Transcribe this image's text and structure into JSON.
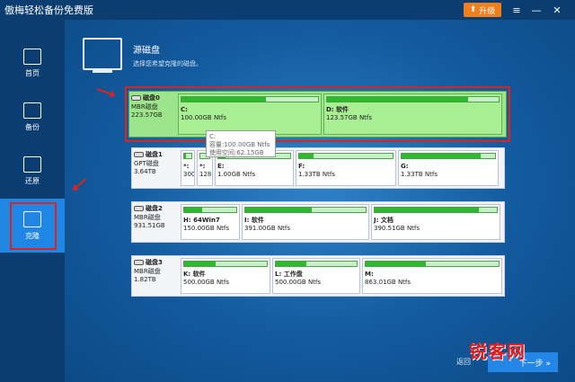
{
  "app": {
    "title": "傲梅轻松备份免费版",
    "upgrade_label": "升级",
    "win_controls": [
      "≡",
      "—",
      "✕"
    ]
  },
  "sidebar": {
    "items": [
      {
        "label": "首页",
        "icon": "home-icon"
      },
      {
        "label": "备份",
        "icon": "backup-icon"
      },
      {
        "label": "还原",
        "icon": "restore-icon"
      },
      {
        "label": "克隆",
        "icon": "clone-icon",
        "active": true
      }
    ]
  },
  "header": {
    "title": "源磁盘",
    "subtitle": "选择您希望克隆的磁盘。",
    "icon": "monitor-icon"
  },
  "disks": [
    {
      "name": "磁盘0",
      "type": "MBR磁盘",
      "size": "223.57GB",
      "selected": true,
      "partitions": [
        {
          "label": "C:",
          "size": "100.00GB Ntfs",
          "used": 0.62
        },
        {
          "label": "D: 软件",
          "size": "123.57GB Ntfs",
          "used": 0.82
        }
      ]
    },
    {
      "name": "磁盘1",
      "type": "GPT磁盘",
      "size": "3.64TB",
      "partitions": [
        {
          "label": "*:",
          "size": "300...",
          "used": 0.3
        },
        {
          "label": "*:",
          "size": "128...",
          "used": 0.0
        },
        {
          "label": "E:",
          "size": "1.00GB Ntfs",
          "used": 0.1
        },
        {
          "label": "F:",
          "size": "1.33TB Ntfs",
          "used": 0.15
        },
        {
          "label": "G:",
          "size": "1.33TB Ntfs",
          "used": 0.85
        }
      ]
    },
    {
      "name": "磁盘2",
      "type": "MBR磁盘",
      "size": "931.51GB",
      "partitions": [
        {
          "label": "H: 64Win7",
          "size": "150.00GB Ntfs",
          "used": 0.35
        },
        {
          "label": "I: 软件",
          "size": "391.00GB Ntfs",
          "used": 0.55
        },
        {
          "label": "J: 文档",
          "size": "390.51GB Ntfs",
          "used": 0.85
        }
      ]
    },
    {
      "name": "磁盘3",
      "type": "MBR磁盘",
      "size": "1.82TB",
      "partitions": [
        {
          "label": "K: 软件",
          "size": "500.00GB Ntfs",
          "used": 0.38
        },
        {
          "label": "L: 工作盘",
          "size": "500.00GB Ntfs",
          "used": 0.38
        },
        {
          "label": "M:",
          "size": "863.01GB Ntfs",
          "used": 0.45
        }
      ]
    }
  ],
  "tooltip": {
    "title": "C:",
    "capacity": "容量:100.00GB Ntfs",
    "used": "使用空间:62.15GB"
  },
  "footer": {
    "back_label": "返回",
    "next_label": "下一步 »"
  },
  "watermark": "锐客网",
  "colors": {
    "accent": "#2487e8",
    "upgrade": "#f0801e",
    "highlight": "#d9251d",
    "used_bar": "#2db82d"
  }
}
